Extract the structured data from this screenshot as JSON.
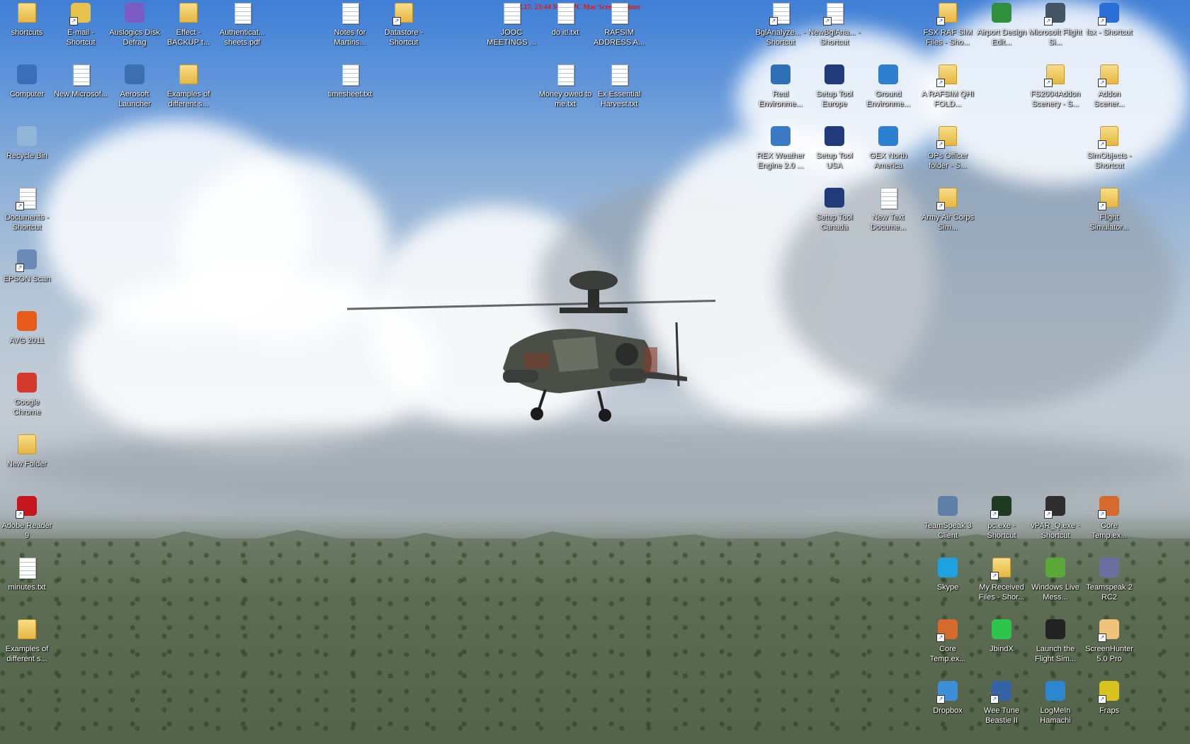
{
  "overlay": {
    "timestamp": "02.17. 23:44 MAC-PC Mac ScreenHunter"
  },
  "colors": {
    "sky_top": "#3f7fd6",
    "timestamp_text": "#e21414",
    "label_text": "#ffffff"
  },
  "icons": [
    {
      "label": "shortcuts",
      "kind": "folder",
      "icon": "folder-icon",
      "col": 0,
      "row": 0
    },
    {
      "label": "E-mail - Shortcut",
      "kind": "app",
      "icon": "email-app-icon",
      "color": "#e7c24a",
      "shortcut": true,
      "col": 1,
      "row": 0
    },
    {
      "label": "Auslogics Disk Defrag",
      "kind": "app",
      "icon": "defrag-icon",
      "color": "#7a5cc4",
      "col": 2,
      "row": 0
    },
    {
      "label": "Effect - BACKUP t...",
      "kind": "folder",
      "icon": "folder-icon",
      "col": 3,
      "row": 0
    },
    {
      "label": "Authenticat... sheets.pdf",
      "kind": "doc",
      "icon": "pdf-document-icon",
      "col": 4,
      "row": 0
    },
    {
      "label": "Notes for Martins...",
      "kind": "doc",
      "icon": "text-document-icon",
      "col": 6,
      "row": 0
    },
    {
      "label": "Datastore - Shortcut",
      "kind": "folder",
      "icon": "folder-shortcut-icon",
      "shortcut": true,
      "col": 7,
      "row": 0
    },
    {
      "label": "JOOC MEETINGS ...",
      "kind": "doc",
      "icon": "text-document-icon",
      "col": 9,
      "row": 0
    },
    {
      "label": "do it!.txt",
      "kind": "doc",
      "icon": "text-document-icon",
      "col": 10,
      "row": 0
    },
    {
      "label": "RAFSIM ADDRESS A...",
      "kind": "doc",
      "icon": "text-document-icon",
      "col": 11,
      "row": 0
    },
    {
      "label": "BglAnalyze... - Shortcut",
      "kind": "doc",
      "icon": "bglanalyzer-icon",
      "shortcut": true,
      "col": 14,
      "row": 0
    },
    {
      "label": "NewBglAna... - Shortcut",
      "kind": "doc",
      "icon": "bglanalyzer-icon",
      "shortcut": true,
      "col": 15,
      "row": 0
    },
    {
      "label": "FSX RAF SIM Files - Sho...",
      "kind": "folder",
      "icon": "folder-shortcut-icon",
      "shortcut": true,
      "col": 17,
      "row": 0
    },
    {
      "label": "Airport Design Edit...",
      "kind": "app",
      "icon": "airport-design-editor-icon",
      "color": "#2f8f3a",
      "col": 18,
      "row": 0
    },
    {
      "label": "Microsoft Flight Si...",
      "kind": "app",
      "icon": "flight-simulator-icon",
      "color": "#445566",
      "shortcut": true,
      "col": 19,
      "row": 0
    },
    {
      "label": "fsx - Shortcut",
      "kind": "app",
      "icon": "fsx-icon",
      "color": "#2a6fd6",
      "shortcut": true,
      "col": 20,
      "row": 0
    },
    {
      "label": "Computer",
      "kind": "app",
      "icon": "computer-icon",
      "color": "#3a6fb8",
      "col": 0,
      "row": 1
    },
    {
      "label": "New Microsof...",
      "kind": "doc",
      "icon": "word-document-icon",
      "col": 1,
      "row": 1
    },
    {
      "label": "Aerosoft Launcher",
      "kind": "app",
      "icon": "aerosoft-icon",
      "color": "#3b6fb0",
      "col": 2,
      "row": 1
    },
    {
      "label": "Examples of different s...",
      "kind": "folder",
      "icon": "folder-icon",
      "col": 3,
      "row": 1
    },
    {
      "label": "timesheet.txt",
      "kind": "doc",
      "icon": "text-document-icon",
      "col": 6,
      "row": 1
    },
    {
      "label": "Money owed to me.txt",
      "kind": "doc",
      "icon": "text-document-icon",
      "col": 10,
      "row": 1
    },
    {
      "label": "Ex Essential Harvest.txt",
      "kind": "doc",
      "icon": "text-document-icon",
      "col": 11,
      "row": 1
    },
    {
      "label": "Real Environme...",
      "kind": "app",
      "icon": "rex-icon",
      "color": "#2e6fb5",
      "col": 14,
      "row": 1
    },
    {
      "label": "Setup Tool Europe",
      "kind": "app",
      "icon": "globe-icon",
      "color": "#203a7a",
      "col": 15,
      "row": 1
    },
    {
      "label": "Ground Environme...",
      "kind": "app",
      "icon": "gex-icon",
      "color": "#2d7fd0",
      "col": 16,
      "row": 1
    },
    {
      "label": "A RAFSIM QHI FOLD...",
      "kind": "folder",
      "icon": "folder-shortcut-icon",
      "shortcut": true,
      "col": 17,
      "row": 1
    },
    {
      "label": "FS2004Addon Scenery - S...",
      "kind": "folder",
      "icon": "folder-shortcut-icon",
      "shortcut": true,
      "col": 19,
      "row": 1
    },
    {
      "label": "Addon Scener...",
      "kind": "folder",
      "icon": "folder-shortcut-icon",
      "shortcut": true,
      "col": 20,
      "row": 1
    },
    {
      "label": "Recycle Bin",
      "kind": "app",
      "icon": "recycle-bin-icon",
      "color": "#8fb6d6",
      "col": 0,
      "row": 2
    },
    {
      "label": "REX Weather Engine 2.0 ...",
      "kind": "app",
      "icon": "rex-weather-icon",
      "color": "#3c7ac6",
      "col": 14,
      "row": 2
    },
    {
      "label": "Setup Tool USA",
      "kind": "app",
      "icon": "globe-icon",
      "color": "#203a7a",
      "col": 15,
      "row": 2
    },
    {
      "label": "GEX North America",
      "kind": "app",
      "icon": "gex-icon",
      "color": "#2d7fd0",
      "col": 16,
      "row": 2
    },
    {
      "label": "OPs Officer folder - S...",
      "kind": "folder",
      "icon": "folder-shortcut-icon",
      "shortcut": true,
      "col": 17,
      "row": 2
    },
    {
      "label": "SimObjects - Shortcut",
      "kind": "folder",
      "icon": "folder-shortcut-icon",
      "shortcut": true,
      "col": 20,
      "row": 2
    },
    {
      "label": "Documents - Shortcut",
      "kind": "doc",
      "icon": "documents-shortcut-icon",
      "shortcut": true,
      "col": 0,
      "row": 3
    },
    {
      "label": "Setup Tool Canada",
      "kind": "app",
      "icon": "globe-icon",
      "color": "#203a7a",
      "col": 15,
      "row": 3
    },
    {
      "label": "New Text Docume...",
      "kind": "doc",
      "icon": "text-document-icon",
      "col": 16,
      "row": 3
    },
    {
      "label": "Army Air Corps Sim...",
      "kind": "folder",
      "icon": "folder-shortcut-icon",
      "shortcut": true,
      "col": 17,
      "row": 3
    },
    {
      "label": "Flight Simulator...",
      "kind": "folder",
      "icon": "folder-shortcut-icon",
      "shortcut": true,
      "col": 20,
      "row": 3
    },
    {
      "label": "EPSON Scan",
      "kind": "app",
      "icon": "scanner-icon",
      "color": "#6a8ab8",
      "shortcut": true,
      "col": 0,
      "row": 4,
      "short": true
    },
    {
      "label": "AVG 2011",
      "kind": "app",
      "icon": "avg-icon",
      "color": "#e85b1a",
      "col": 0,
      "row": 5,
      "short": true
    },
    {
      "label": "Google Chrome",
      "kind": "app",
      "icon": "chrome-icon",
      "color": "#d33a2c",
      "col": 0,
      "row": 6
    },
    {
      "label": "New Folder",
      "kind": "folder",
      "icon": "folder-icon",
      "col": 0,
      "row": 7,
      "short": true
    },
    {
      "label": "Adobe Reader 9",
      "kind": "app",
      "icon": "adobe-reader-icon",
      "color": "#c4161c",
      "shortcut": true,
      "col": 0,
      "row": 8
    },
    {
      "label": "minutes.txt",
      "kind": "doc",
      "icon": "text-document-icon",
      "col": 0,
      "row": 9
    },
    {
      "label": "Examples of different s...",
      "kind": "folder",
      "icon": "folder-icon",
      "col": 0,
      "row": 10
    },
    {
      "label": "TeamSpeak 3 Client",
      "kind": "app",
      "icon": "teamspeak-icon",
      "color": "#5d7fa8",
      "col": 17,
      "row": 8
    },
    {
      "label": "pc.exe - Shortcut",
      "kind": "app",
      "icon": "pc-exe-icon",
      "color": "#1f3a22",
      "shortcut": true,
      "col": 18,
      "row": 8
    },
    {
      "label": "vPAR_Q.exe - Shortcut",
      "kind": "app",
      "icon": "vpar-icon",
      "color": "#2d2d2d",
      "shortcut": true,
      "col": 19,
      "row": 8
    },
    {
      "label": "Core Temp.ex...",
      "kind": "app",
      "icon": "core-temp-icon",
      "color": "#d66a2c",
      "shortcut": true,
      "col": 20,
      "row": 8
    },
    {
      "label": "Skype",
      "kind": "app",
      "icon": "skype-icon",
      "color": "#1ea1e0",
      "col": 17,
      "row": 9
    },
    {
      "label": "My Received Files - Shor...",
      "kind": "folder",
      "icon": "folder-shortcut-icon",
      "shortcut": true,
      "col": 18,
      "row": 9
    },
    {
      "label": "Windows Live Mess...",
      "kind": "app",
      "icon": "messenger-icon",
      "color": "#5aa83a",
      "col": 19,
      "row": 9
    },
    {
      "label": "Teamspeak 2 RC2",
      "kind": "app",
      "icon": "teamspeak2-icon",
      "color": "#6b6fa0",
      "col": 20,
      "row": 9
    },
    {
      "label": "Core Temp.ex...",
      "kind": "app",
      "icon": "core-temp-icon",
      "color": "#d66a2c",
      "shortcut": true,
      "col": 17,
      "row": 10
    },
    {
      "label": "JbindX",
      "kind": "app",
      "icon": "jbindx-icon",
      "color": "#2ec44a",
      "col": 18,
      "row": 10
    },
    {
      "label": "Launch the Flight Sim...",
      "kind": "app",
      "icon": "launch-flight-sim-icon",
      "color": "#222222",
      "col": 19,
      "row": 10
    },
    {
      "label": "ScreenHunter 5.0 Pro",
      "kind": "app",
      "icon": "screenhunter-icon",
      "color": "#f1c27a",
      "shortcut": true,
      "col": 20,
      "row": 10
    },
    {
      "label": "Dropbox",
      "kind": "app",
      "icon": "dropbox-icon",
      "color": "#3e8fd8",
      "shortcut": true,
      "col": 17,
      "row": 11
    },
    {
      "label": "Wee Tune Beastie II",
      "kind": "app",
      "icon": "wee-tune-icon",
      "color": "#3563a8",
      "shortcut": true,
      "col": 18,
      "row": 11
    },
    {
      "label": "LogMeIn Hamachi",
      "kind": "app",
      "icon": "hamachi-icon",
      "color": "#2d86d0",
      "col": 19,
      "row": 11
    },
    {
      "label": "Fraps",
      "kind": "app",
      "icon": "fraps-icon",
      "color": "#d8c21e",
      "shortcut": true,
      "col": 20,
      "row": 11
    }
  ]
}
